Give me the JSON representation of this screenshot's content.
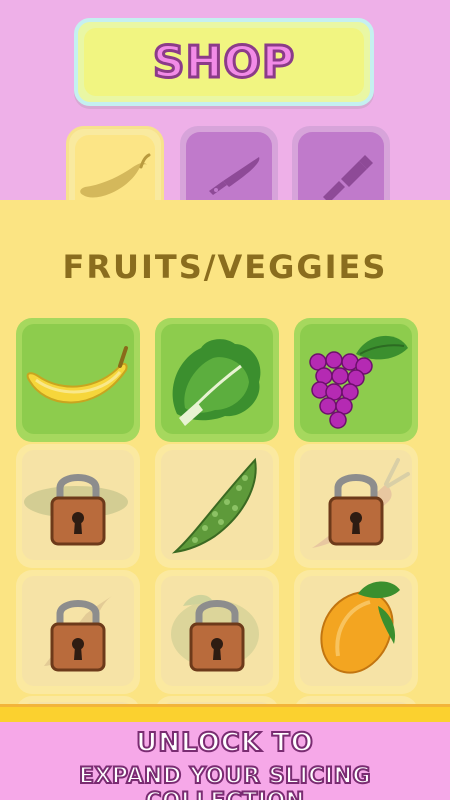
{
  "header": {
    "title": "SHOP"
  },
  "tabs": [
    {
      "icon": "pepper-icon",
      "selected": true
    },
    {
      "icon": "knife-icon",
      "selected": false
    },
    {
      "icon": "paint-brush-icon",
      "selected": false
    }
  ],
  "section": {
    "title": "FRUITS/VEGGIES"
  },
  "items": [
    {
      "icon": "banana-icon",
      "locked": false
    },
    {
      "icon": "lettuce-icon",
      "locked": false
    },
    {
      "icon": "grapes-icon",
      "locked": false
    },
    {
      "icon": "cucumber-icon",
      "locked": true
    },
    {
      "icon": "bitter-gourd-icon",
      "locked": false
    },
    {
      "icon": "carrot-icon",
      "locked": true
    },
    {
      "icon": "pepper-icon",
      "locked": true
    },
    {
      "icon": "lemon-icon",
      "locked": true
    },
    {
      "icon": "mango-icon",
      "locked": false
    }
  ],
  "footer": {
    "line1": "UNLOCK TO",
    "line2": "EXPAND YOUR SLICING COLLECTION"
  },
  "colors": {
    "top_bg": "#eeb0e8",
    "panel_bg": "#fbe483",
    "unlocked_cell": "#8dcc4d",
    "locked_cell": "#f6e3a6",
    "title_text": "#8a6d1e"
  }
}
